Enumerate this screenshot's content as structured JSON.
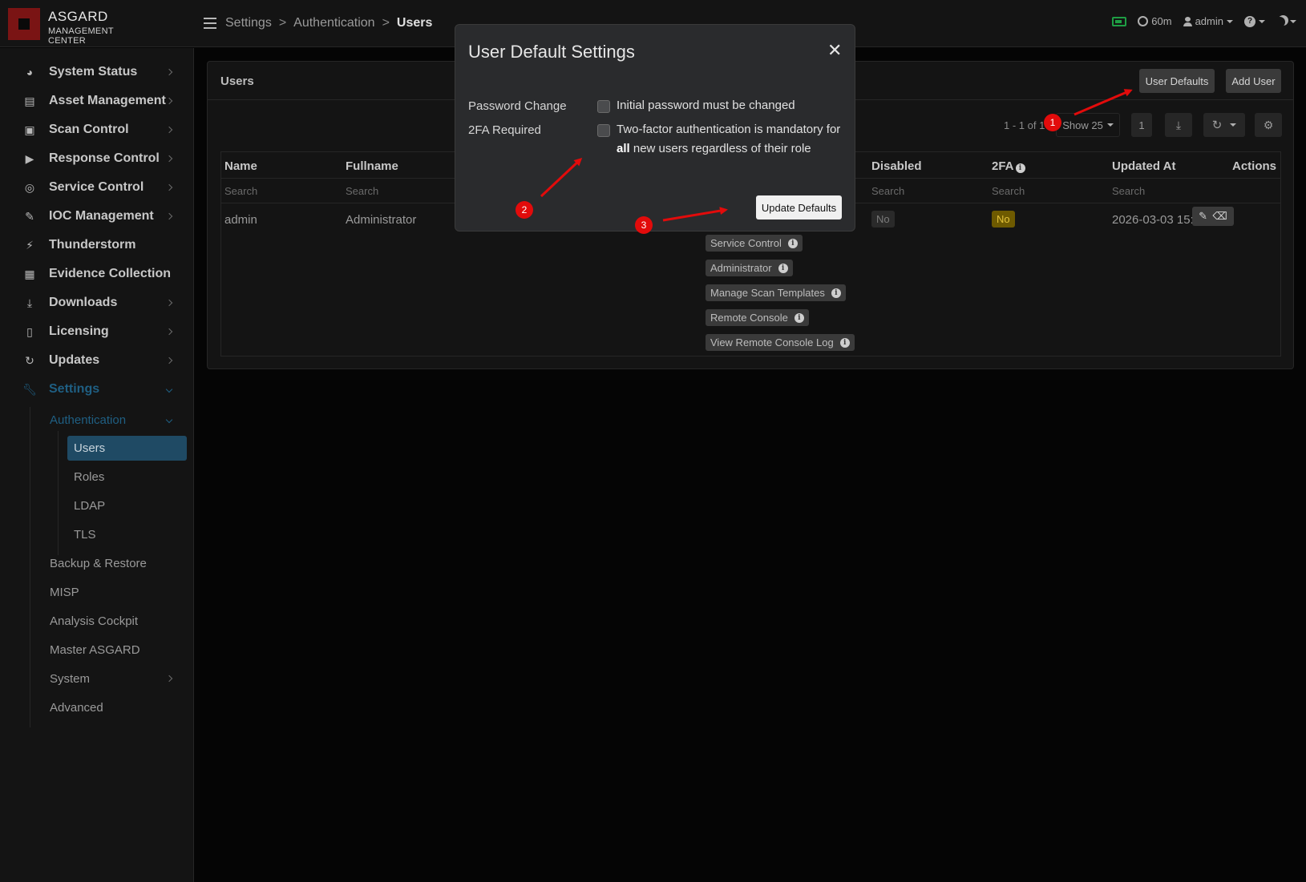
{
  "app": {
    "logo_title": "ASGARD",
    "logo_subtitle": "MANAGEMENT CENTER"
  },
  "breadcrumb": [
    "Settings",
    "Authentication",
    "Users"
  ],
  "topbar": {
    "timeout": "60m",
    "user": "admin"
  },
  "sidebar": {
    "items": [
      {
        "label": "System Status",
        "icon": "gauge-icon"
      },
      {
        "label": "Asset Management",
        "icon": "server-icon"
      },
      {
        "label": "Scan Control",
        "icon": "scan-icon"
      },
      {
        "label": "Response Control",
        "icon": "play-icon"
      },
      {
        "label": "Service Control",
        "icon": "target-icon"
      },
      {
        "label": "IOC Management",
        "icon": "ioc-icon"
      },
      {
        "label": "Thunderstorm",
        "icon": "bolt-icon"
      },
      {
        "label": "Evidence Collection",
        "icon": "boxes-icon"
      },
      {
        "label": "Downloads",
        "icon": "download-icon"
      },
      {
        "label": "Licensing",
        "icon": "license-icon"
      },
      {
        "label": "Updates",
        "icon": "sync-icon"
      },
      {
        "label": "Settings",
        "icon": "wrench-icon"
      }
    ],
    "settings_sub": {
      "authentication": "Authentication",
      "auth_items": [
        "Users",
        "Roles",
        "LDAP",
        "TLS"
      ],
      "others": [
        "Backup & Restore",
        "MISP",
        "Analysis Cockpit",
        "Master ASGARD",
        "System",
        "Advanced"
      ]
    }
  },
  "card": {
    "title": "Users",
    "user_defaults_btn": "User Defaults",
    "add_user_btn": "Add User",
    "pager": "1 - 1 of 1",
    "show": "Show 25",
    "page": "1"
  },
  "table": {
    "headers": [
      "Name",
      "Fullname",
      "Disabled",
      "2FA",
      "Updated At",
      "Actions"
    ],
    "search_placeholder": "Search",
    "row": {
      "name": "admin",
      "fullname": "Administrator",
      "roles": [
        "Service Control",
        "Administrator",
        "Manage Scan Templates",
        "Remote Console",
        "View Remote Console Log"
      ],
      "disabled": "No",
      "twofa": "No",
      "updated_at": "2026-03-03 15:00:56"
    }
  },
  "modal": {
    "title": "User Default Settings",
    "password_label": "Password Change",
    "password_text": "Initial password must be changed",
    "twofa_label": "2FA Required",
    "twofa_text_line1": "Two-factor authentication is mandatory for",
    "twofa_text_bold": "all",
    "twofa_text_line2": " new users regardless of their role",
    "update_btn": "Update Defaults"
  },
  "annotations": [
    "1",
    "2",
    "3"
  ],
  "colors": {
    "accent": "#1f5f83",
    "marker": "#e20b0b",
    "status_green": "#1e9e44",
    "badge_yellow": "#e4c23a"
  }
}
